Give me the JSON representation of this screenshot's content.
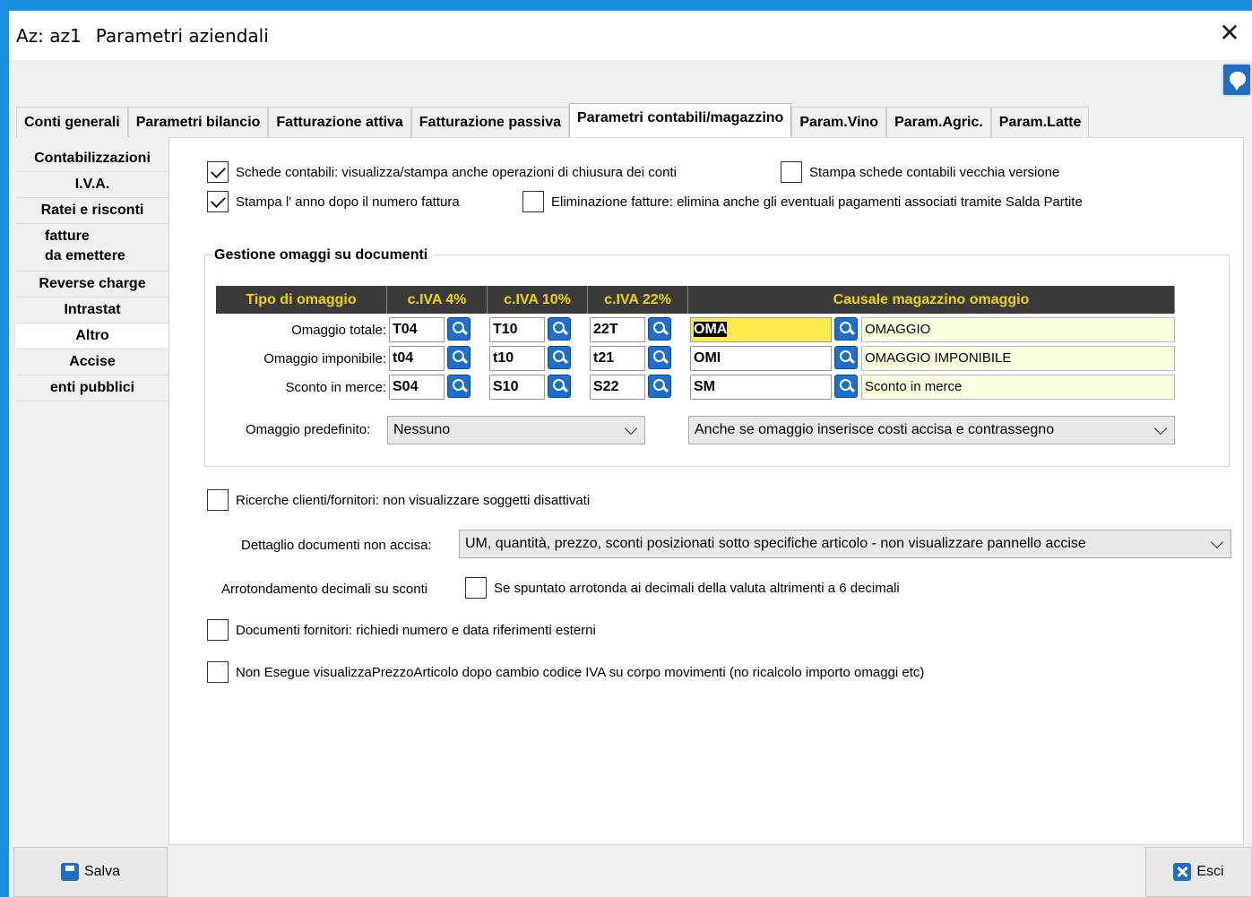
{
  "window": {
    "app": "Az: az1",
    "title": "Parametri aziendali"
  },
  "tabs": [
    {
      "label": "Conti generali"
    },
    {
      "label": "Parametri bilancio"
    },
    {
      "label": "Fatturazione attiva"
    },
    {
      "label": "Fatturazione passiva"
    },
    {
      "label": "Parametri contabili/magazzino",
      "active": true
    },
    {
      "label": "Param.Vino"
    },
    {
      "label": "Param.Agric."
    },
    {
      "label": "Param.Latte"
    }
  ],
  "sidebar": [
    {
      "label": "Contabilizzazioni"
    },
    {
      "label": "I.V.A."
    },
    {
      "label": "Ratei e risconti"
    },
    {
      "label1": "fatture",
      "label2": "da emettere"
    },
    {
      "label": "Reverse charge"
    },
    {
      "label": "Intrastat"
    },
    {
      "label": "Altro",
      "active": true
    },
    {
      "label": "Accise"
    },
    {
      "label": "enti pubblici"
    }
  ],
  "checks": {
    "schede": {
      "label": "Schede contabili: visualizza/stampa anche operazioni di chiusura dei conti",
      "checked": true
    },
    "vecchia": {
      "label": "Stampa schede contabili vecchia versione",
      "checked": false
    },
    "anno": {
      "label": "Stampa l' anno dopo il numero fattura",
      "checked": true
    },
    "elimina": {
      "label": "Eliminazione fatture: elimina anche gli eventuali pagamenti associati tramite Salda Partite",
      "checked": false
    },
    "ricerche": {
      "label": "Ricerche clienti/fornitori: non visualizzare soggetti disattivati",
      "checked": false
    },
    "arrotonda": {
      "label": "Se spuntato arrotonda ai decimali della valuta altrimenti a 6 decimali",
      "checked": false
    },
    "fornitori": {
      "label": "Documenti fornitori: richiedi numero e data riferimenti esterni",
      "checked": false
    },
    "nonesegue": {
      "label": "Non Esegue visualizzaPrezzoArticolo dopo cambio codice IVA su corpo movimenti (no ricalcolo importo omaggi etc)",
      "checked": false
    }
  },
  "omaggi": {
    "title": "Gestione omaggi su documenti",
    "headers": [
      "Tipo di omaggio",
      "c.IVA 4%",
      "c.IVA 10%",
      "c.IVA 22%",
      "Causale magazzino omaggio"
    ],
    "rows": [
      {
        "label": "Omaggio totale:",
        "iva4": "T04",
        "iva10": "T10",
        "iva22": "22T",
        "causale": "OMA",
        "descr": "OMAGGIO"
      },
      {
        "label": "Omaggio imponibile:",
        "iva4": "t04",
        "iva10": "t10",
        "iva22": "t21",
        "causale": "OMI",
        "descr": "OMAGGIO IMPONIBILE"
      },
      {
        "label": "Sconto in merce:",
        "iva4": "S04",
        "iva10": "S10",
        "iva22": "S22",
        "causale": "SM",
        "descr": "Sconto in merce"
      }
    ],
    "predefinito_label": "Omaggio predefinito:",
    "predefinito_value": "Nessuno",
    "accisa_value": "Anche se omaggio inserisce costi accisa e contrassegno"
  },
  "dettaglio": {
    "label": "Dettaglio documenti non accisa:",
    "value": "UM, quantità, prezzo, sconti posizionati sotto specifiche articolo - non  visualizzare pannello accise"
  },
  "arrotondamento_label": "Arrotondamento decimali su sconti",
  "buttons": {
    "save": "Salva",
    "exit": "Esci"
  }
}
